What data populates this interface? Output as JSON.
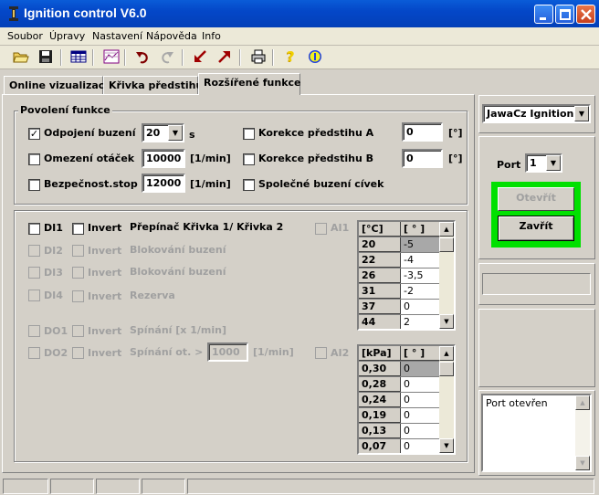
{
  "window": {
    "title": "Ignition control V6.0",
    "app_icon": "ignition-app-icon",
    "buttons": [
      "minimize-icon",
      "maximize-icon",
      "close-icon"
    ]
  },
  "menu": {
    "items": [
      {
        "label": "Soubor"
      },
      {
        "label": "Úpravy"
      },
      {
        "label": "Nastavení"
      },
      {
        "label": "Nápověda"
      },
      {
        "label": "Info"
      }
    ]
  },
  "toolbar": {
    "icons": [
      "open-folder-icon",
      "save-icon",
      "table-icon",
      "chart-icon",
      "undo-icon",
      "redo-icon",
      "download-arrow-icon",
      "upload-arrow-icon",
      "print-icon",
      "help-icon",
      "info-icon"
    ]
  },
  "tabs": [
    {
      "label": "Online vizualizace",
      "active": false
    },
    {
      "label": "Křivka předstihu",
      "active": false
    },
    {
      "label": "Rozšířené funkce",
      "active": true
    }
  ],
  "povoleni": {
    "legend": "Povolení funkce",
    "odpojeni": {
      "label": "Odpojení buzení",
      "checked": true,
      "value": "20",
      "unit": "s"
    },
    "omezeni": {
      "label": "Omezení otáček",
      "checked": false,
      "value": "10000",
      "unit": "[1/min]"
    },
    "bezpecnost": {
      "label": "Bezpečnost.stop",
      "checked": false,
      "value": "12000",
      "unit": "[1/min]"
    },
    "korekceA": {
      "label": "Korekce předstihu A",
      "checked": false,
      "value": "0",
      "unit": "[°]"
    },
    "korekceB": {
      "label": "Korekce předstihu B",
      "checked": false,
      "value": "0",
      "unit": "[°]"
    },
    "spolecne": {
      "label": "Společné buzení cívek",
      "checked": false
    }
  },
  "io": {
    "invert_label": "Invert",
    "rows": [
      {
        "id": "DI1",
        "enabled": true,
        "function": "Přepínač Křivka 1/ Křivka 2"
      },
      {
        "id": "DI2",
        "enabled": false,
        "function": "Blokování buzení"
      },
      {
        "id": "DI3",
        "enabled": false,
        "function": "Blokování buzení"
      },
      {
        "id": "DI4",
        "enabled": false,
        "function": "Rezerva"
      },
      {
        "id": "DO1",
        "enabled": false,
        "function": "Spínání [x 1/min]"
      },
      {
        "id": "DO2",
        "enabled": false,
        "function": "Spínání ot. >",
        "value": "1000",
        "unit": "[1/min]"
      }
    ],
    "ai1_label": "AI1",
    "ai2_label": "AI2"
  },
  "temp_table": {
    "headers": [
      "[°C]",
      "[ ° ]"
    ],
    "rows": [
      [
        "20",
        "-5"
      ],
      [
        "22",
        "-4"
      ],
      [
        "26",
        "-3,5"
      ],
      [
        "31",
        "-2"
      ],
      [
        "37",
        "0"
      ],
      [
        "44",
        "2"
      ]
    ]
  },
  "pressure_table": {
    "headers": [
      "[kPa]",
      "[ ° ]"
    ],
    "rows": [
      [
        "0,30",
        "0"
      ],
      [
        "0,28",
        "0"
      ],
      [
        "0,24",
        "0"
      ],
      [
        "0,19",
        "0"
      ],
      [
        "0,13",
        "0"
      ],
      [
        "0,07",
        "0"
      ]
    ]
  },
  "right_panel": {
    "device_select": "JawaCz Ignition",
    "port_label": "Port",
    "port_value": "1",
    "open_button": "Otevřít",
    "close_button": "Zavřít",
    "log_text": "Port otevřen",
    "highlight_color": "#00e000"
  }
}
